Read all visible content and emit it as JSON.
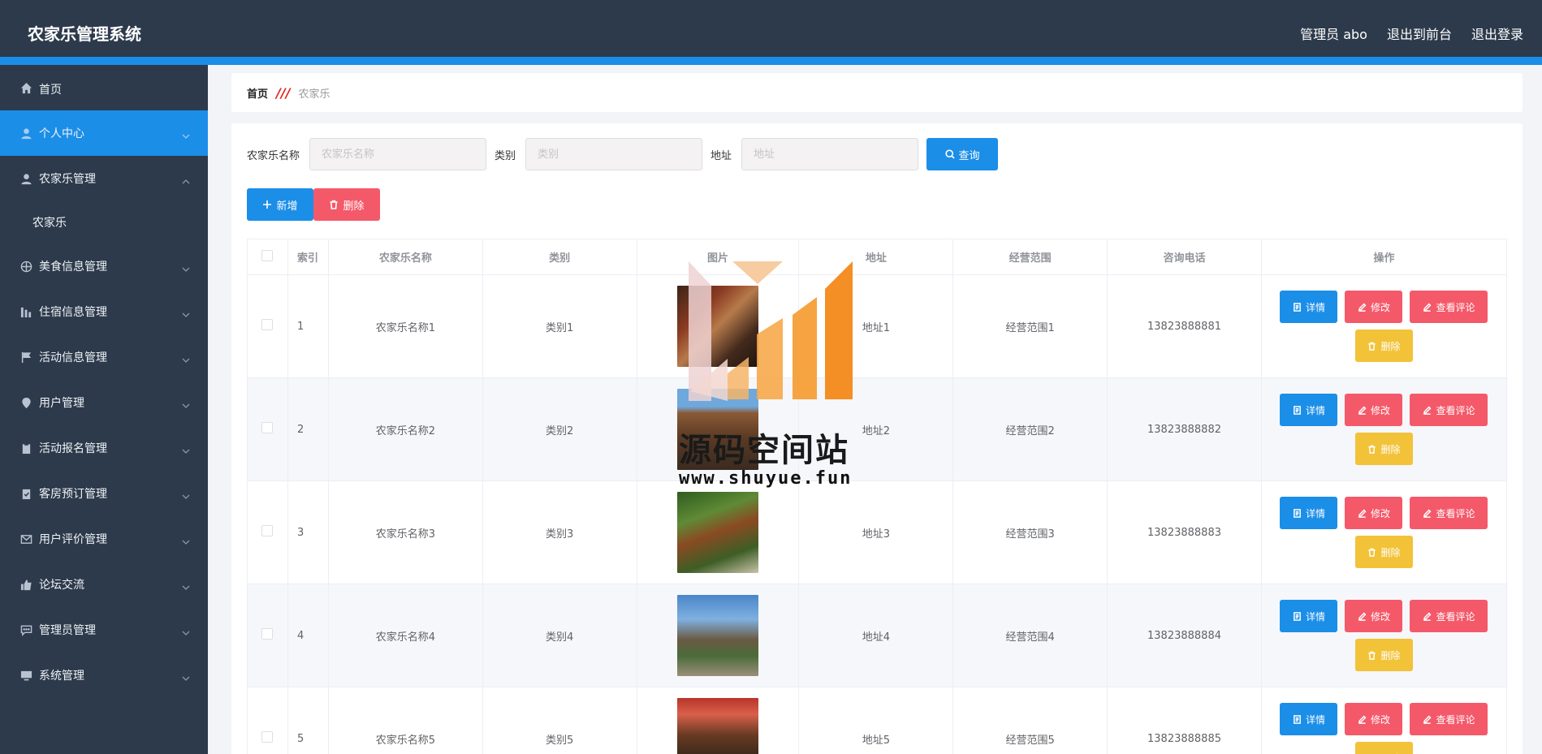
{
  "header": {
    "title": "农家乐管理系统",
    "user": "管理员 abo",
    "to_front": "退出到前台",
    "logout": "退出登录"
  },
  "sidebar": {
    "items": [
      {
        "label": "首页",
        "icon": "home-icon"
      },
      {
        "label": "个人中心",
        "icon": "user-icon"
      },
      {
        "label": "农家乐管理",
        "icon": "user-icon"
      },
      {
        "label": "农家乐",
        "icon": ""
      },
      {
        "label": "美食信息管理",
        "icon": "globe-icon"
      },
      {
        "label": "住宿信息管理",
        "icon": "chart-icon"
      },
      {
        "label": "活动信息管理",
        "icon": "flag-icon"
      },
      {
        "label": "用户管理",
        "icon": "pin-icon"
      },
      {
        "label": "活动报名管理",
        "icon": "clipboard-icon"
      },
      {
        "label": "客房预订管理",
        "icon": "check-doc-icon"
      },
      {
        "label": "用户评价管理",
        "icon": "mail-icon"
      },
      {
        "label": "论坛交流",
        "icon": "thumb-icon"
      },
      {
        "label": "管理员管理",
        "icon": "chat-icon"
      },
      {
        "label": "系统管理",
        "icon": "monitor-icon"
      }
    ]
  },
  "breadcrumb": {
    "home": "首页",
    "current": "农家乐"
  },
  "search": {
    "name_label": "农家乐名称",
    "name_placeholder": "农家乐名称",
    "type_label": "类别",
    "type_placeholder": "类别",
    "addr_label": "地址",
    "addr_placeholder": "地址",
    "query_label": "查询"
  },
  "actions": {
    "add_label": "新增",
    "delete_label": "删除"
  },
  "table": {
    "headers": [
      "索引",
      "农家乐名称",
      "类别",
      "图片",
      "地址",
      "经营范围",
      "咨询电话",
      "操作"
    ],
    "rows": [
      {
        "idx": "1",
        "name": "农家乐名称1",
        "type": "类别1",
        "addr": "地址1",
        "scope": "经营范围1",
        "phone": "13823888881"
      },
      {
        "idx": "2",
        "name": "农家乐名称2",
        "type": "类别2",
        "addr": "地址2",
        "scope": "经营范围2",
        "phone": "13823888882"
      },
      {
        "idx": "3",
        "name": "农家乐名称3",
        "type": "类别3",
        "addr": "地址3",
        "scope": "经营范围3",
        "phone": "13823888883"
      },
      {
        "idx": "4",
        "name": "农家乐名称4",
        "type": "类别4",
        "addr": "地址4",
        "scope": "经营范围4",
        "phone": "13823888884"
      },
      {
        "idx": "5",
        "name": "农家乐名称5",
        "type": "类别5",
        "addr": "地址5",
        "scope": "经营范围5",
        "phone": "13823888885"
      }
    ],
    "ops": {
      "detail": "详情",
      "edit": "修改",
      "review": "查看评论",
      "delete": "删除"
    }
  },
  "watermark": {
    "text": "源码空间站",
    "url": "www.shuyue.fun"
  },
  "colors": {
    "header_bg": "#2d3a4b",
    "accent": "#1b8ee8",
    "danger": "#f4596a",
    "warning": "#f2c238"
  }
}
